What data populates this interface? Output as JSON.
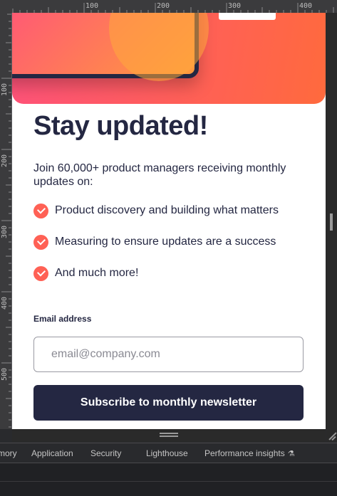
{
  "ruler": {
    "top_labels": [
      "100",
      "200",
      "300",
      "400"
    ],
    "left_labels": [
      "100",
      "200",
      "300",
      "400",
      "500"
    ]
  },
  "page": {
    "heading": "Stay updated!",
    "intro": "Join 60,000+ product managers receiving monthly updates on:",
    "features": [
      "Product discovery and building what matters",
      "Measuring to ensure updates are a success",
      "And much more!"
    ],
    "email_label": "Email address",
    "email_placeholder": "email@company.com",
    "subscribe_label": "Subscribe to monthly newsletter"
  },
  "devtools": {
    "tabs": [
      "mory",
      "Application",
      "Security",
      "Lighthouse",
      "Performance insights"
    ]
  },
  "colors": {
    "accent": "#ff6155",
    "navy": "#242742",
    "devtools_bg": "#292a2d"
  },
  "icons": [
    "check-icon",
    "flask-icon"
  ]
}
